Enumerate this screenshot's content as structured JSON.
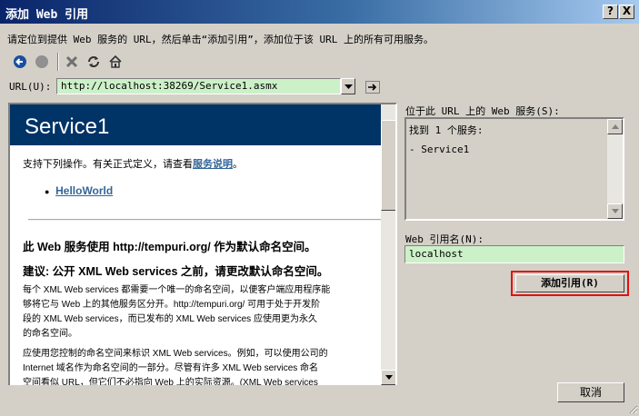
{
  "window": {
    "title": "添加 Web 引用",
    "help_btn": "?",
    "close_btn": "X"
  },
  "instruction": "请定位到提供 Web 服务的 URL，然后单击“添加引用”，添加位于该 URL 上的所有可用服务。",
  "toolbar": {
    "icons": [
      "back-icon",
      "stop-icon",
      "close-icon",
      "refresh-icon",
      "home-icon"
    ]
  },
  "url": {
    "label": "URL(U):",
    "value": "http://localhost:38269/Service1.asmx"
  },
  "browser": {
    "service_title": "Service1",
    "intro_text": "支持下列操作。有关正式定义，请查看",
    "intro_link": "服务说明",
    "intro_end": "。",
    "operations": [
      "HelloWorld"
    ],
    "namespace_heading": "此 Web 服务使用 http://tempuri.org/ 作为默认命名空间。",
    "advice_heading": "建议: 公开 XML Web services 之前，请更改默认命名空间。",
    "para1": [
      "每个 XML Web services 都需要一个唯一的命名空间，以便客户端应用程序能",
      "够将它与 Web 上的其他服务区分开。http://tempuri.org/ 可用于处于开发阶",
      "段的 XML Web services，而已发布的 XML Web services 应使用更为永久",
      "的命名空间。"
    ],
    "para2": [
      "应使用您控制的命名空间来标识 XML Web services。例如，可以使用公司的",
      "Internet 域名作为命名空间的一部分。尽管有许多 XML Web services 命名",
      "空间看似 URL，但它们不必指向 Web 上的实际资源。(XML Web services"
    ]
  },
  "services_panel": {
    "label": "位于此 URL 上的 Web 服务(S):",
    "found": "找到 1 个服务:",
    "items": [
      "- Service1"
    ]
  },
  "ref_name": {
    "label": "Web 引用名(N):",
    "value": "localhost"
  },
  "buttons": {
    "add": "添加引用(R)",
    "cancel": "取消"
  },
  "colors": {
    "title_start": "#0a246a",
    "header_bg": "#003366",
    "link": "#336699",
    "field_bg": "#ccf0c8",
    "highlight": "#e41010"
  }
}
